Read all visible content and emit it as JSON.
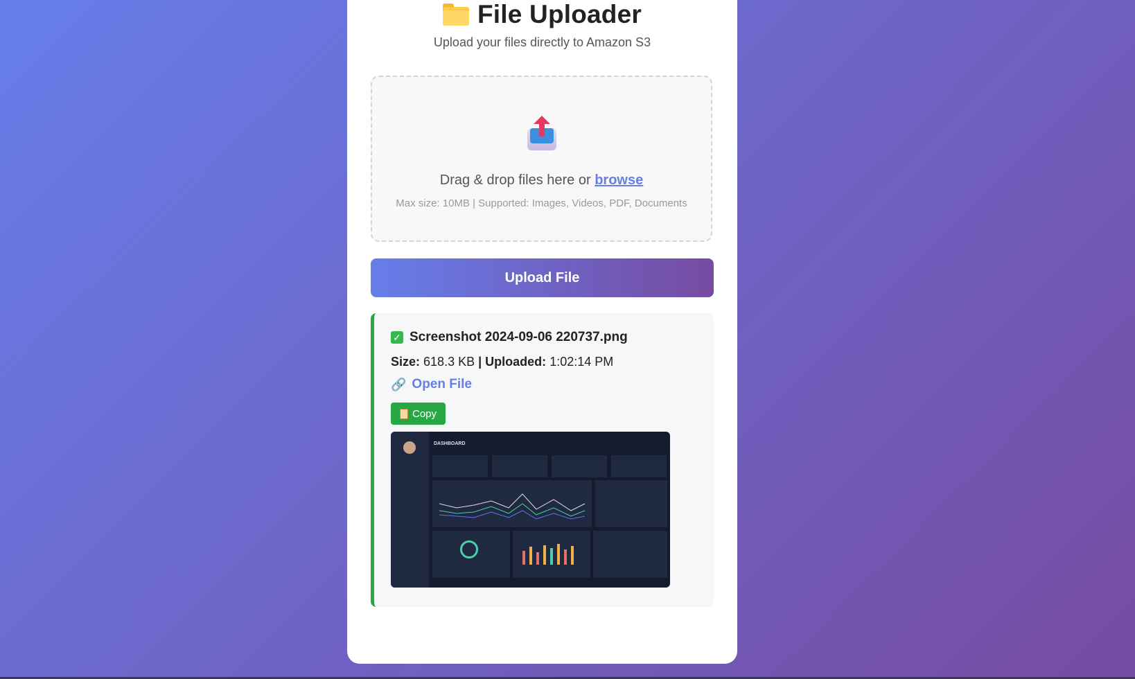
{
  "header": {
    "title": "File Uploader",
    "subtitle": "Upload your files directly to Amazon S3"
  },
  "dropzone": {
    "text_prefix": "Drag & drop files here or",
    "browse_label": "browse",
    "hint": "Max size: 10MB | Supported: Images, Videos, PDF, Documents"
  },
  "upload_button": {
    "label": "Upload File"
  },
  "result": {
    "file_name": "Screenshot 2024-09-06 220737.png",
    "size_label": "Size:",
    "size_value": "618.3 KB",
    "separator": "|",
    "uploaded_label": "Uploaded:",
    "uploaded_value": "1:02:14 PM",
    "open_label": "Open File",
    "copy_label": "Copy"
  },
  "preview": {
    "dashboard_title": "DASHBOARD"
  },
  "colors": {
    "accent": "#667eea",
    "accent_end": "#764ba2",
    "success": "#28a745"
  }
}
